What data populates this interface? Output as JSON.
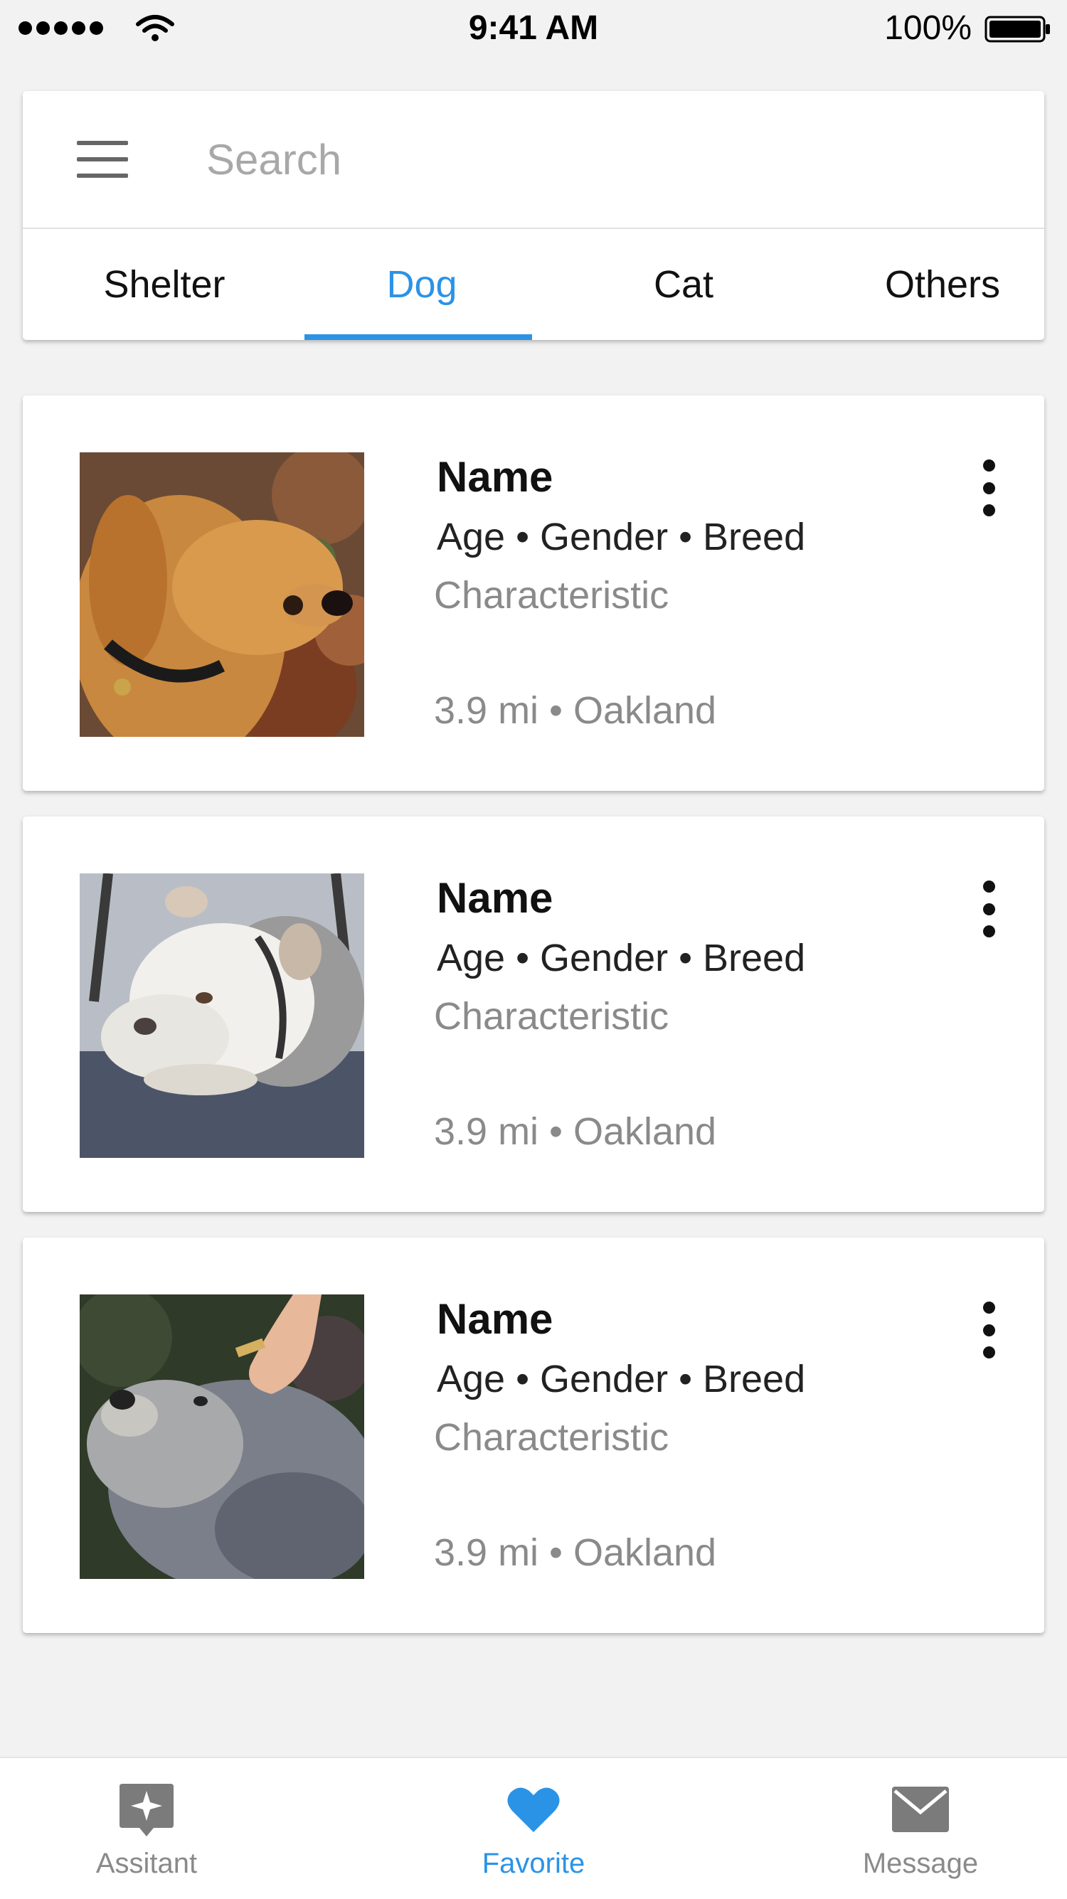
{
  "status_bar": {
    "time": "9:41 AM",
    "battery_percent": "100%",
    "signal_bars": 5
  },
  "search": {
    "placeholder": "Search",
    "value": ""
  },
  "tabs": [
    {
      "label": "Shelter",
      "active": false
    },
    {
      "label": "Dog",
      "active": true
    },
    {
      "label": "Cat",
      "active": false
    },
    {
      "label": "Others",
      "active": false
    }
  ],
  "pets": [
    {
      "name": "Name",
      "info": "Age • Gender • Breed",
      "characteristic": "Characteristic",
      "location": "3.9 mi • Oakland",
      "photo": "golden-retriever-photo"
    },
    {
      "name": "Name",
      "info": "Age • Gender • Breed",
      "characteristic": "Characteristic",
      "location": "3.9 mi • Oakland",
      "photo": "white-bulldog-photo"
    },
    {
      "name": "Name",
      "info": "Age • Gender • Breed",
      "characteristic": "Characteristic",
      "location": "3.9 mi • Oakland",
      "photo": "grey-terrier-photo"
    }
  ],
  "bottom_nav": [
    {
      "label": "Assitant",
      "icon": "assistant-icon",
      "active": false
    },
    {
      "label": "Favorite",
      "icon": "heart-icon",
      "active": true
    },
    {
      "label": "Message",
      "icon": "mail-icon",
      "active": false
    }
  ],
  "colors": {
    "accent": "#2b93e6",
    "background": "#f2f2f2",
    "card": "#ffffff",
    "muted_text": "#8a8a8a"
  }
}
